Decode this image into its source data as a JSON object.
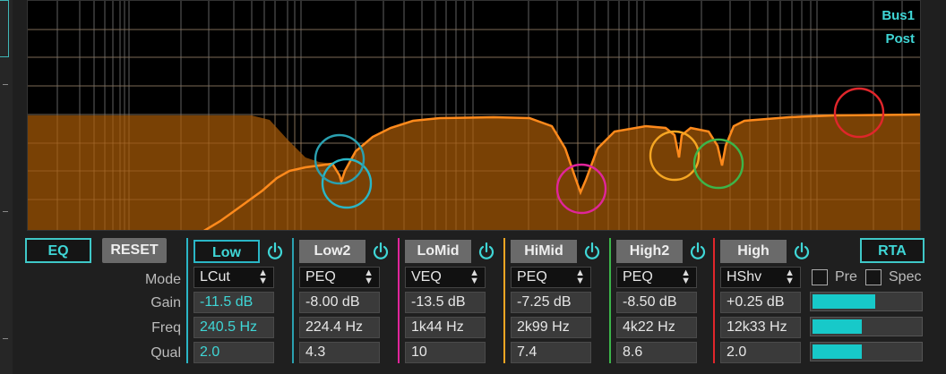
{
  "bus": {
    "line1": "Bus1",
    "line2": "Post"
  },
  "left_buttons": {
    "eq": "EQ",
    "reset": "RESET",
    "rta": "RTA"
  },
  "row_labels": [
    "Mode",
    "Gain",
    "Freq",
    "Qual"
  ],
  "bands": [
    {
      "name": "Low",
      "color": "#2ab6c6",
      "active": true,
      "mode": "LCut",
      "gain": "-11.5 dB",
      "freq": "240.5 Hz",
      "qual": "2.0"
    },
    {
      "name": "Low2",
      "color": "#2aa0b0",
      "active": false,
      "mode": "PEQ",
      "gain": "-8.00 dB",
      "freq": "224.4 Hz",
      "qual": "4.3"
    },
    {
      "name": "LoMid",
      "color": "#e0259a",
      "active": false,
      "mode": "VEQ",
      "gain": "-13.5 dB",
      "freq": "1k44 Hz",
      "qual": "10"
    },
    {
      "name": "HiMid",
      "color": "#f5a623",
      "active": false,
      "mode": "PEQ",
      "gain": "-7.25 dB",
      "freq": "2k99 Hz",
      "qual": "7.4"
    },
    {
      "name": "High2",
      "color": "#3cb54a",
      "active": false,
      "mode": "PEQ",
      "gain": "-8.50 dB",
      "freq": "4k22 Hz",
      "qual": "8.6"
    },
    {
      "name": "High",
      "color": "#e0262b",
      "active": false,
      "mode": "HShv",
      "gain": "+0.25 dB",
      "freq": "12k33 Hz",
      "qual": "2.0"
    }
  ],
  "rta_options": {
    "pre": "Pre",
    "spec": "Spec"
  },
  "meters": [
    0.58,
    0.46,
    0.46
  ],
  "colors": {
    "accent": "#3fd6d6",
    "curve": "#ff8a1c",
    "fill": "#8a4a06"
  }
}
